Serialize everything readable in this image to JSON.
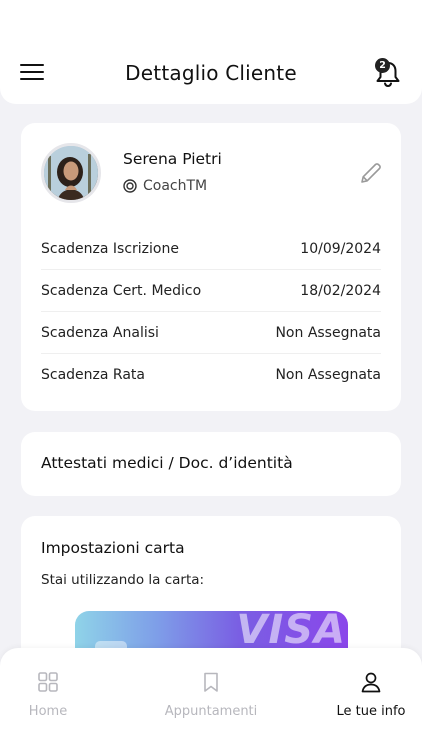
{
  "header": {
    "title": "Dettaglio Cliente",
    "notification_count": "2"
  },
  "client": {
    "name": "Serena Pietri",
    "coach": "CoachTM"
  },
  "info_rows": [
    {
      "label": "Scadenza Iscrizione",
      "value": "10/09/2024"
    },
    {
      "label": "Scadenza Cert. Medico",
      "value": "18/02/2024"
    },
    {
      "label": "Scadenza Analisi",
      "value": "Non Assegnata"
    },
    {
      "label": "Scadenza Rata",
      "value": "Non Assegnata"
    }
  ],
  "docs": {
    "title": "Attestati medici / Doc. d’identità"
  },
  "payment": {
    "title": "Impostazioni carta",
    "subtitle": "Stai utilizzando la carta:",
    "card_brand": "VISA"
  },
  "tabs": [
    {
      "label": "Home",
      "icon": "grid-icon"
    },
    {
      "label": "Appuntamenti",
      "icon": "bookmark-icon"
    },
    {
      "label": "Le tue info",
      "icon": "user-icon"
    }
  ],
  "colors": {
    "background": "#f2f2f6",
    "card": "#ffffff",
    "text": "#111111",
    "inactive_tab": "#b7b7bd",
    "card_gradient_start": "#8fd3e8",
    "card_gradient_end": "#8a46ea"
  }
}
